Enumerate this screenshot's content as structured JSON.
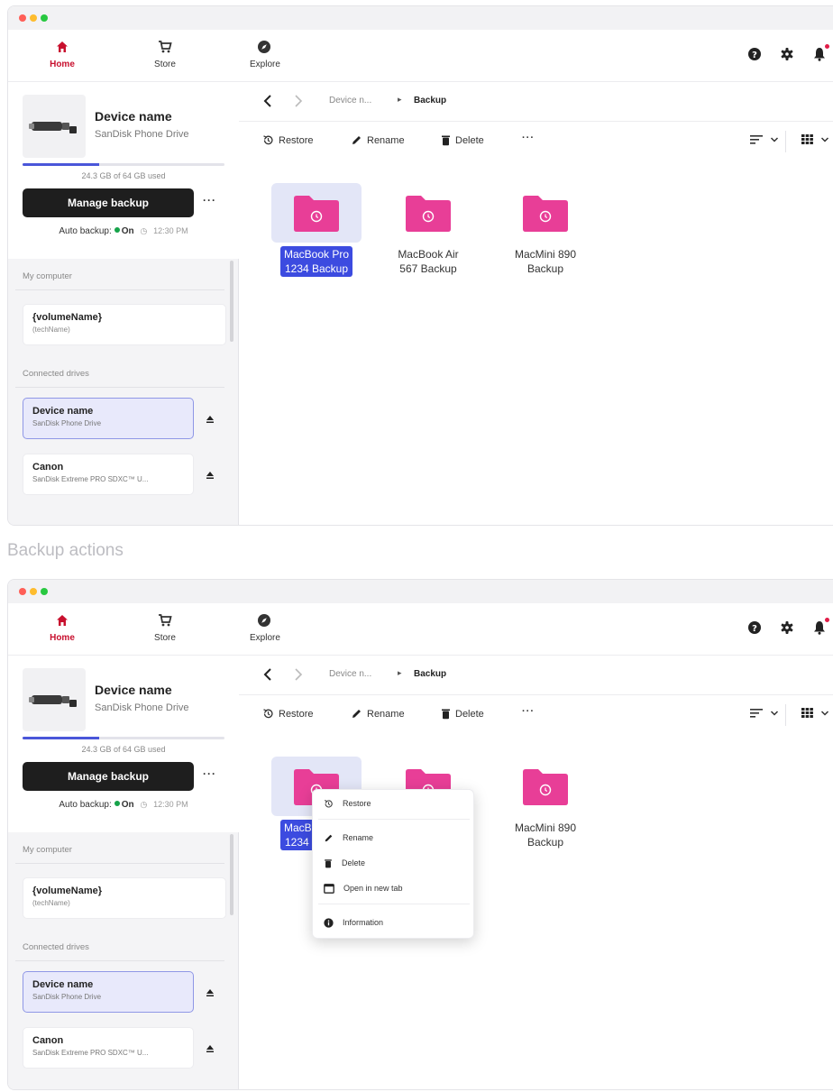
{
  "nav": {
    "home": "Home",
    "store": "Store",
    "explore": "Explore"
  },
  "device": {
    "name": "Device name",
    "sub": "SanDisk Phone Drive",
    "usage_percent": 38,
    "usage_text": "24.3 GB of 64 GB used",
    "manage_label": "Manage backup",
    "more_label": "···",
    "auto_label": "Auto backup:",
    "auto_value": "On",
    "auto_time": "12:30 PM"
  },
  "sections": {
    "my_computer": "My computer",
    "connected": "Connected drives"
  },
  "volume": {
    "name": "{volumeName}",
    "tech": "(techName)"
  },
  "drives": [
    {
      "name": "Device name",
      "sub": "SanDisk Phone Drive"
    },
    {
      "name": "Canon",
      "sub": "SanDisk Extreme PRO SDXC™ U..."
    }
  ],
  "breadcrumb": {
    "parent": "Device n...",
    "sep": "▸",
    "current": "Backup"
  },
  "toolbar": {
    "restore": "Restore",
    "rename": "Rename",
    "delete": "Delete",
    "more": "···"
  },
  "folders": [
    {
      "line1": "MacBook Pro",
      "line2": "1234 Backup"
    },
    {
      "line1": "MacBook Air",
      "line2": "567 Backup"
    },
    {
      "line1": "MacMini 890",
      "line2": "Backup"
    }
  ],
  "section_heading": "Backup actions",
  "context_menu": {
    "restore": "Restore",
    "rename": "Rename",
    "delete": "Delete",
    "open_tab": "Open in new tab",
    "information": "Information"
  },
  "colors": {
    "accent": "#3c4be0",
    "brand_red": "#c8102e",
    "folder_pink": "#e83e97",
    "on_green": "#16a34a"
  }
}
